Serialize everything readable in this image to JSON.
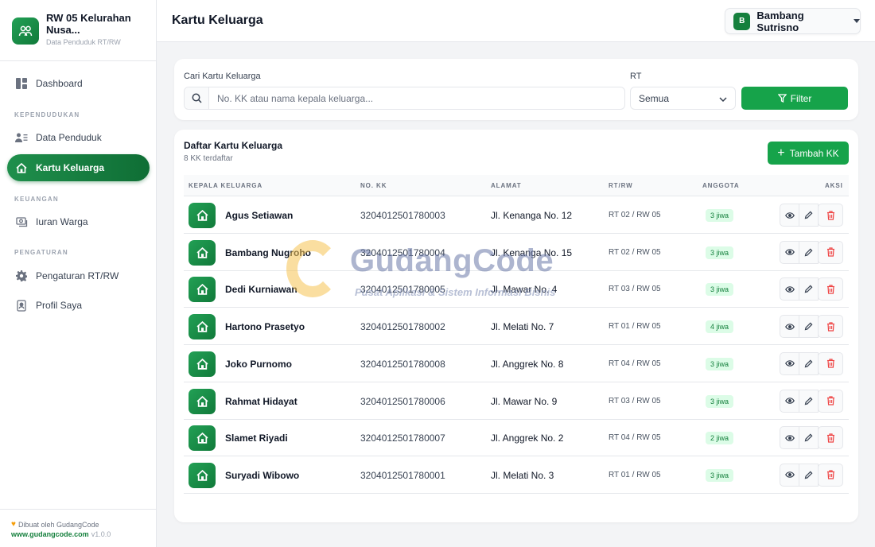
{
  "sidebar": {
    "brand_name": "RW 05 Kelurahan Nusa...",
    "brand_sub": "Data Penduduk RT/RW",
    "dashboard": "Dashboard",
    "section_kependudukan": "KEPENDUDUKAN",
    "data_penduduk": "Data Penduduk",
    "kartu_keluarga": "Kartu Keluarga",
    "section_keuangan": "KEUANGAN",
    "iuran_warga": "Iuran Warga",
    "section_pengaturan": "PENGATURAN",
    "pengaturan_rtrw": "Pengaturan RT/RW",
    "profil_saya": "Profil Saya",
    "footer_made_by": "Dibuat oleh GudangCode",
    "footer_site": "www.gudangcode.com",
    "footer_version": "v1.0.0"
  },
  "header": {
    "title": "Kartu Keluarga",
    "user_initial": "B",
    "user_name": "Bambang Sutrisno"
  },
  "filter": {
    "search_label": "Cari Kartu Keluarga",
    "search_placeholder": "No. KK atau nama kepala keluarga...",
    "rt_label": "RT",
    "rt_value": "Semua",
    "filter_button": "Filter"
  },
  "list": {
    "title": "Daftar Kartu Keluarga",
    "count": "8 KK terdaftar",
    "add_button": "Tambah KK",
    "columns": {
      "kepala": "KEPALA KELUARGA",
      "no_kk": "NO. KK",
      "alamat": "ALAMAT",
      "rtrw": "RT/RW",
      "anggota": "ANGGOTA",
      "aksi": "AKSI"
    },
    "rows": [
      {
        "name": "Agus Setiawan",
        "no_kk": "3204012501780003",
        "alamat": "Jl. Kenanga No. 12",
        "rtrw": "RT 02 / RW 05",
        "anggota": "3 jiwa"
      },
      {
        "name": "Bambang Nugroho",
        "no_kk": "3204012501780004",
        "alamat": "Jl. Kenanga No. 15",
        "rtrw": "RT 02 / RW 05",
        "anggota": "3 jiwa"
      },
      {
        "name": "Dedi Kurniawan",
        "no_kk": "3204012501780005",
        "alamat": "Jl. Mawar No. 4",
        "rtrw": "RT 03 / RW 05",
        "anggota": "3 jiwa"
      },
      {
        "name": "Hartono Prasetyo",
        "no_kk": "3204012501780002",
        "alamat": "Jl. Melati No. 7",
        "rtrw": "RT 01 / RW 05",
        "anggota": "4 jiwa"
      },
      {
        "name": "Joko Purnomo",
        "no_kk": "3204012501780008",
        "alamat": "Jl. Anggrek No. 8",
        "rtrw": "RT 04 / RW 05",
        "anggota": "3 jiwa"
      },
      {
        "name": "Rahmat Hidayat",
        "no_kk": "3204012501780006",
        "alamat": "Jl. Mawar No. 9",
        "rtrw": "RT 03 / RW 05",
        "anggota": "3 jiwa"
      },
      {
        "name": "Slamet Riyadi",
        "no_kk": "3204012501780007",
        "alamat": "Jl. Anggrek No. 2",
        "rtrw": "RT 04 / RW 05",
        "anggota": "2 jiwa"
      },
      {
        "name": "Suryadi Wibowo",
        "no_kk": "3204012501780001",
        "alamat": "Jl. Melati No. 3",
        "rtrw": "RT 01 / RW 05",
        "anggota": "3 jiwa"
      }
    ]
  },
  "watermark": {
    "title": "GudangCode",
    "subtitle": "Pusat Aplikasi & Sistem Informasi Bisnis"
  },
  "colors": {
    "primary": "#16a34a",
    "primary_dark": "#0f6e35",
    "badge_bg": "#dcfce7",
    "danger": "#ef4444"
  },
  "icons": {
    "brand": "people-icon",
    "row": "house-icon",
    "view": "eye-icon",
    "edit": "pencil-icon",
    "delete": "trash-icon"
  }
}
